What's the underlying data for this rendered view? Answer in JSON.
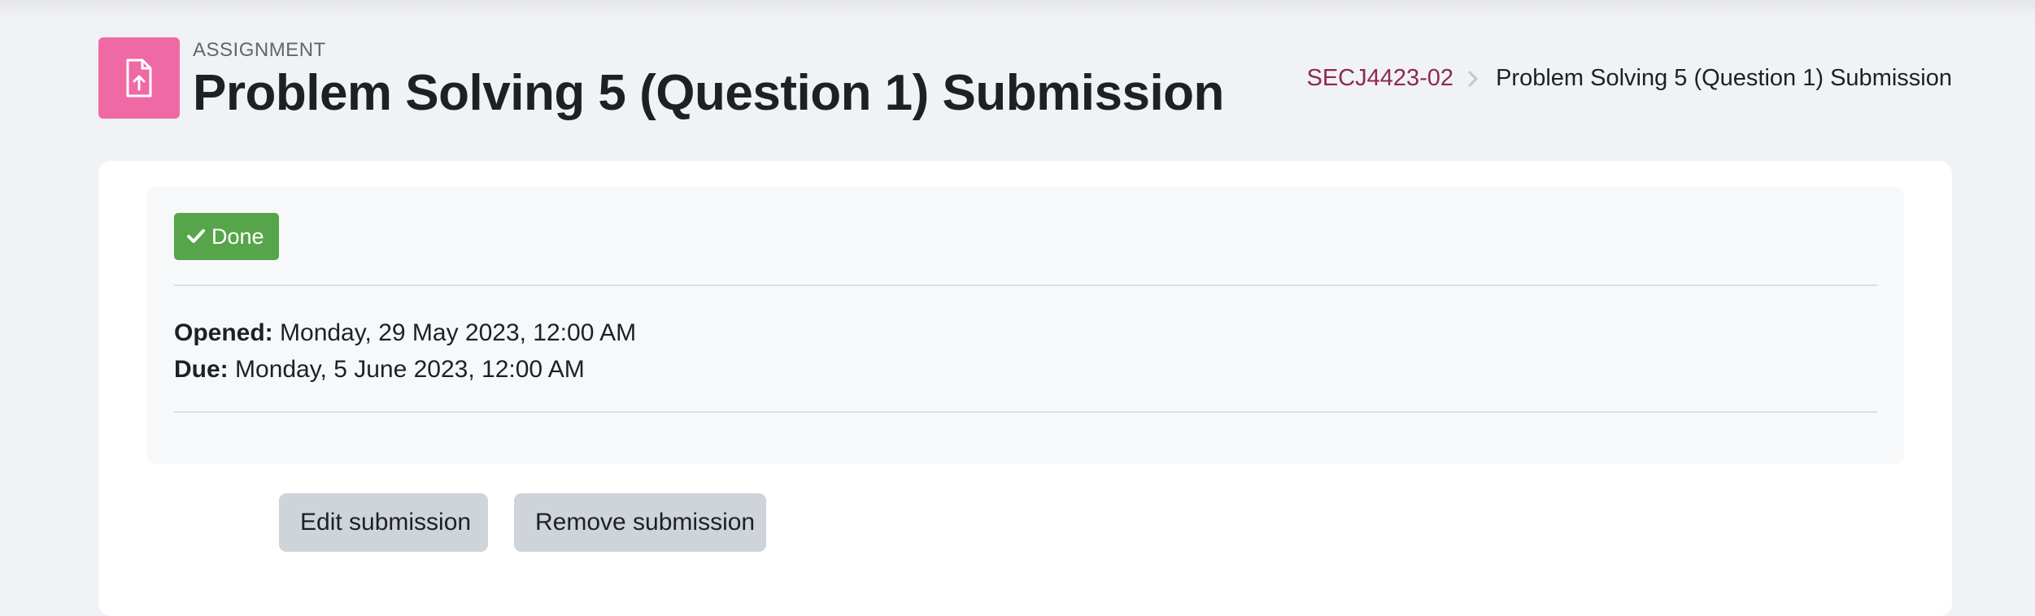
{
  "header": {
    "activity_type": "ASSIGNMENT",
    "title": "Problem Solving 5 (Question 1) Submission",
    "icon": "assignment-upload-icon",
    "icon_color": "#ef6aa4"
  },
  "breadcrumb": {
    "course": "SECJ4423-02",
    "separator_icon": "chevron-right-icon",
    "current": "Problem Solving 5 (Question 1) Submission"
  },
  "completion": {
    "label": "Done",
    "icon": "check-icon",
    "color": "#57a54a"
  },
  "dates": {
    "opened_label": "Opened:",
    "opened_value": "Monday, 29 May 2023, 12:00 AM",
    "due_label": "Due:",
    "due_value": "Monday, 5 June 2023, 12:00 AM"
  },
  "actions": {
    "edit_label": "Edit submission",
    "remove_label": "Remove submission"
  },
  "colors": {
    "link": "#8c2a4d",
    "button_bg": "#ced4da",
    "page_bg": "#f1f2f6"
  }
}
